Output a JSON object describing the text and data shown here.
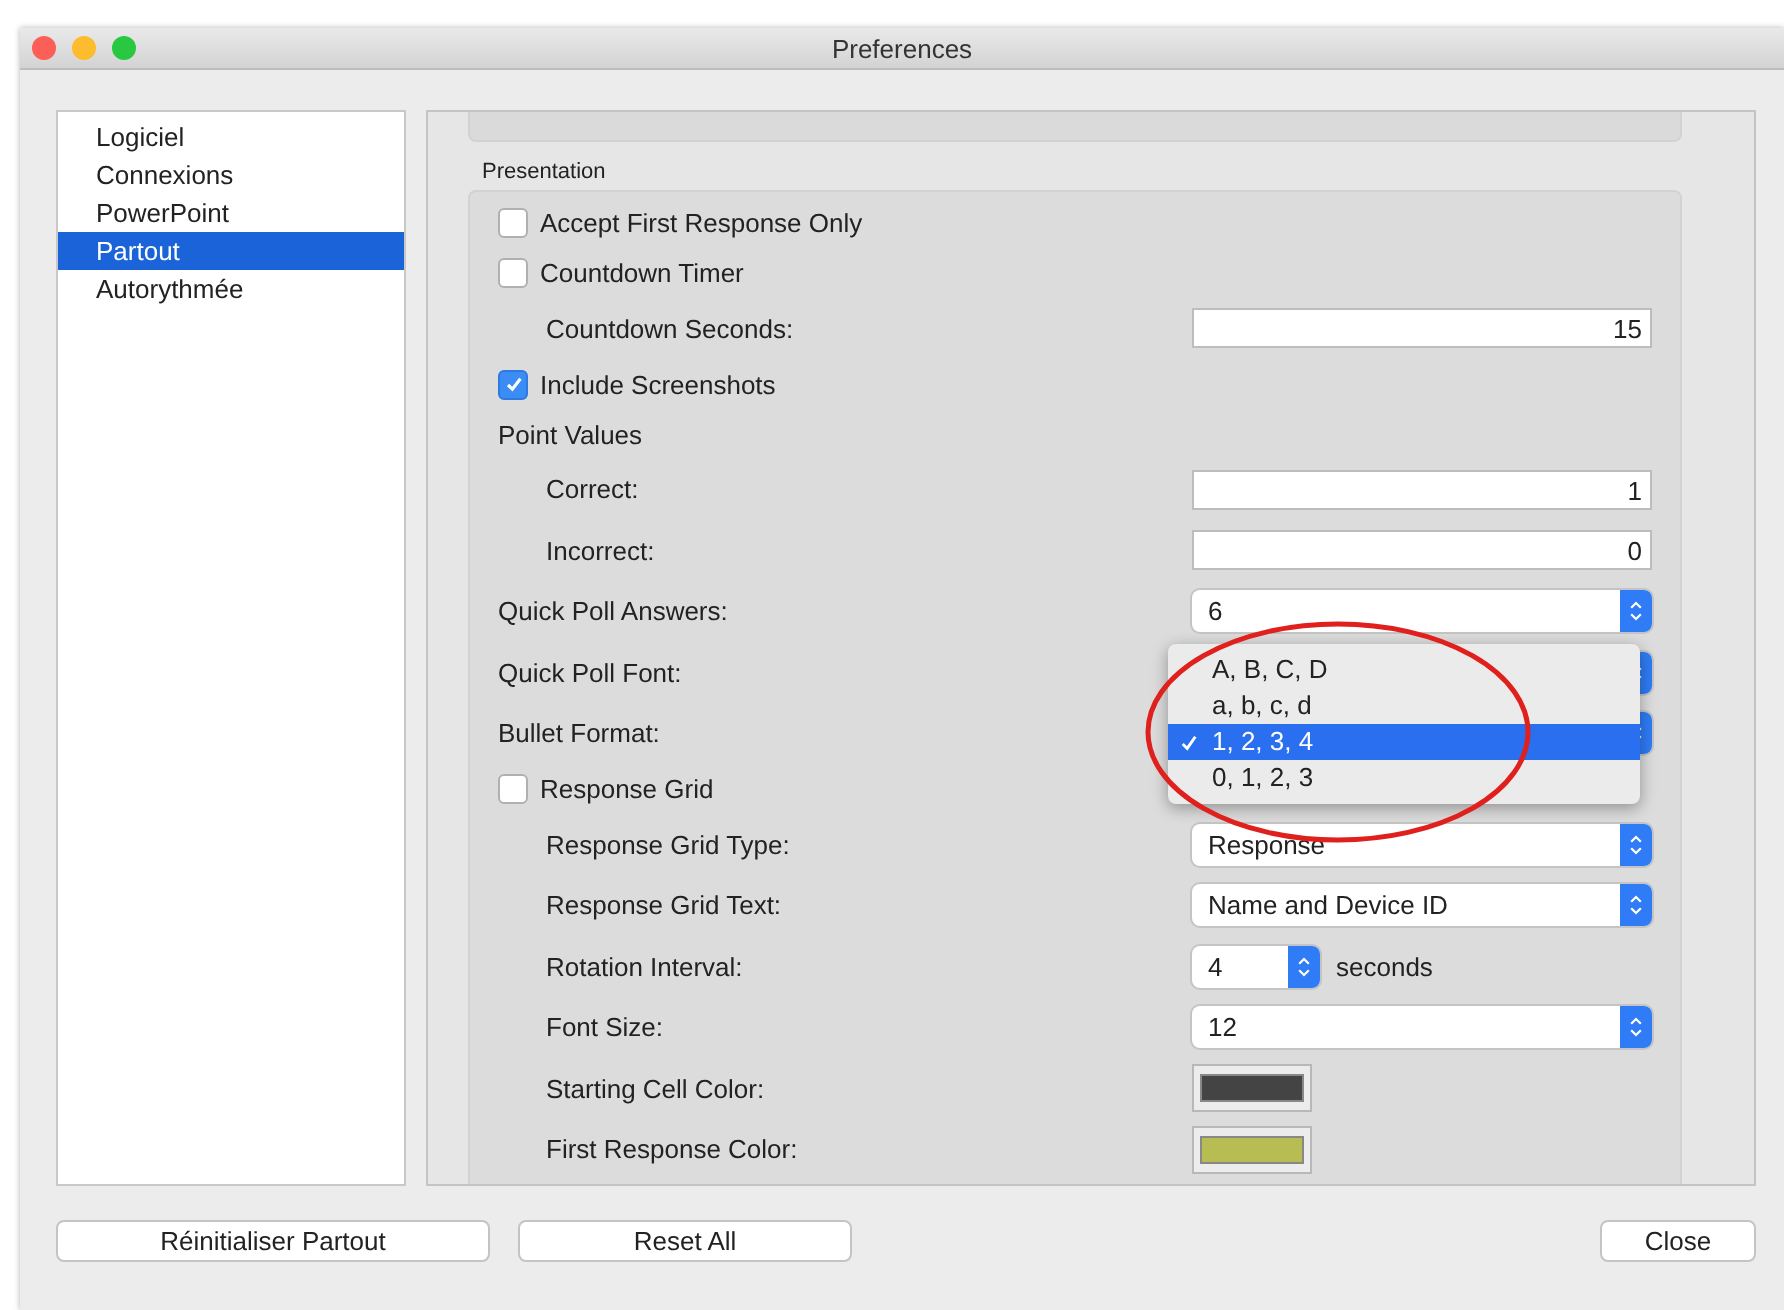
{
  "window": {
    "title": "Preferences"
  },
  "sidebar": {
    "items": [
      {
        "label": "Logiciel",
        "selected": false
      },
      {
        "label": "Connexions",
        "selected": false
      },
      {
        "label": "PowerPoint",
        "selected": false
      },
      {
        "label": "Partout",
        "selected": true
      },
      {
        "label": "Autorythmée",
        "selected": false
      }
    ]
  },
  "section": {
    "title": "Presentation",
    "rows": [
      {
        "kind": "checkbox",
        "label": "Accept First Response Only",
        "checked": false
      },
      {
        "kind": "checkbox",
        "label": "Countdown Timer",
        "checked": false,
        "children": [
          {
            "kind": "text-field",
            "label": "Countdown Seconds:",
            "value": "15"
          }
        ]
      },
      {
        "kind": "checkbox",
        "label": "Include Screenshots",
        "checked": true
      },
      {
        "kind": "heading",
        "label": "Point Values",
        "children": [
          {
            "kind": "text-field",
            "label": "Correct:",
            "value": "1"
          },
          {
            "kind": "text-field",
            "label": "Incorrect:",
            "value": "0"
          }
        ]
      },
      {
        "kind": "popup",
        "label": "Quick Poll Answers:",
        "value": "6"
      },
      {
        "kind": "popup",
        "label": "Quick Poll Font:"
      },
      {
        "kind": "popup",
        "label": "Bullet Format:"
      },
      {
        "kind": "checkbox",
        "label": "Response Grid",
        "checked": false,
        "children": [
          {
            "kind": "popup",
            "label": "Response Grid Type:",
            "value": "Response"
          },
          {
            "kind": "popup",
            "label": "Response Grid Text:",
            "value": "Name and Device ID"
          },
          {
            "kind": "stepper-popup",
            "label": "Rotation Interval:",
            "value": "4",
            "unit": "seconds"
          },
          {
            "kind": "popup",
            "label": "Font Size:",
            "value": "12"
          },
          {
            "kind": "color",
            "label": "Starting Cell Color:",
            "color": "#444444"
          },
          {
            "kind": "color",
            "label": "First Response Color:",
            "color": "#b7bd52"
          }
        ]
      }
    ]
  },
  "popup_menu": {
    "options": [
      {
        "label": "A, B, C, D",
        "selected": false
      },
      {
        "label": "a, b, c, d",
        "selected": false
      },
      {
        "label": "1, 2, 3, 4",
        "selected": true
      },
      {
        "label": "0, 1, 2, 3",
        "selected": false
      }
    ]
  },
  "buttons": [
    {
      "label": "Réinitialiser Partout"
    },
    {
      "label": "Reset All"
    },
    {
      "label": "Close"
    }
  ]
}
